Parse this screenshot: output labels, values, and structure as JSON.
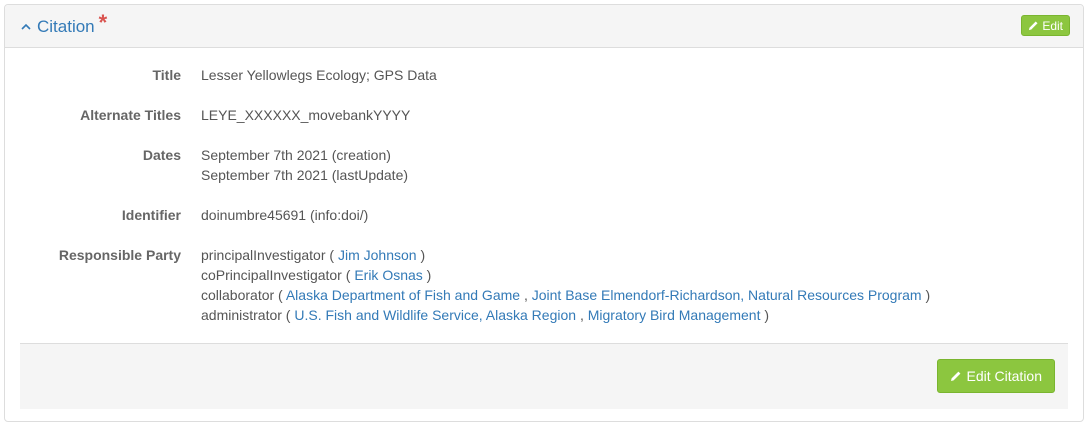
{
  "panel": {
    "title": "Citation",
    "required_marker": "*",
    "edit_button_label": "Edit"
  },
  "fields": {
    "title": {
      "label": "Title",
      "value": "Lesser Yellowlegs Ecology; GPS Data"
    },
    "alternate_titles": {
      "label": "Alternate Titles",
      "value": "LEYE_XXXXXX_movebankYYYY"
    },
    "dates": {
      "label": "Dates",
      "values": [
        "September 7th 2021 (creation)",
        "September 7th 2021 (lastUpdate)"
      ]
    },
    "identifier": {
      "label": "Identifier",
      "value": "doinumbre45691 (info:doi/)"
    },
    "responsible_party": {
      "label": "Responsible Party",
      "entries": [
        {
          "role": "principalInvestigator",
          "parties": [
            "Jim Johnson"
          ]
        },
        {
          "role": "coPrincipalInvestigator",
          "parties": [
            "Erik Osnas"
          ]
        },
        {
          "role": "collaborator",
          "parties": [
            "Alaska Department of Fish and Game",
            "Joint Base Elmendorf-Richardson, Natural Resources Program"
          ]
        },
        {
          "role": "administrator",
          "parties": [
            "U.S. Fish and Wildlife Service, Alaska Region",
            "Migratory Bird Management"
          ]
        }
      ]
    }
  },
  "footer": {
    "edit_citation_label": "Edit Citation"
  },
  "colors": {
    "accent": "#337ab7",
    "success": "#8cc63f",
    "required": "#d9534f"
  },
  "icons": [
    "chevron-up-icon",
    "pencil-icon"
  ]
}
